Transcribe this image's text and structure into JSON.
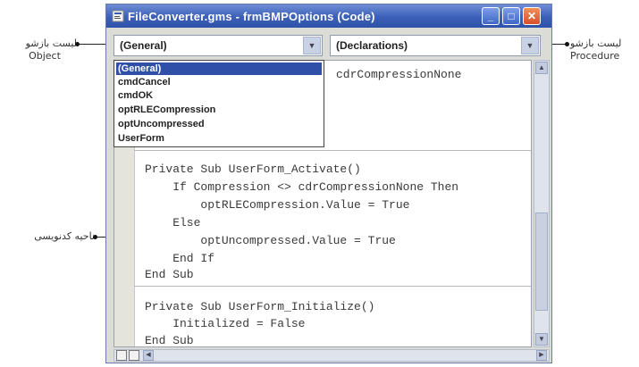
{
  "window": {
    "title": "FileConverter.gms - frmBMPOptions (Code)",
    "minimize_glyph": "_",
    "maximize_glyph": "□",
    "close_glyph": "✕"
  },
  "object_combo": {
    "value": "(General)"
  },
  "procedure_combo": {
    "value": "(Declarations)"
  },
  "object_dropdown": {
    "items": [
      "(General)",
      "cmdCancel",
      "cmdOK",
      "optRLECompression",
      "optUncompressed",
      "UserForm"
    ],
    "selected_index": 0
  },
  "code": {
    "top_line": "cdrCompressionNone",
    "block1": [
      "Private Sub UserForm_Activate()",
      "    If Compression <> cdrCompressionNone Then",
      "        optRLECompression.Value = True",
      "    Else",
      "        optUncompressed.Value = True",
      "    End If",
      "End Sub"
    ],
    "block2": [
      "Private Sub UserForm_Initialize()",
      "    Initialized = False",
      "End Sub"
    ]
  },
  "annotations": {
    "object_list_fa": "لیست بازشو",
    "object_list_en": "Object",
    "procedure_list_fa": "لیست بازشو",
    "procedure_list_en": "Procedure",
    "code_area_fa": "ناحیه کدنویسی"
  },
  "colors": {
    "titlebar": "#3b5fb8",
    "selection": "#2f4fa8",
    "keyword": "#2c3f8e"
  }
}
